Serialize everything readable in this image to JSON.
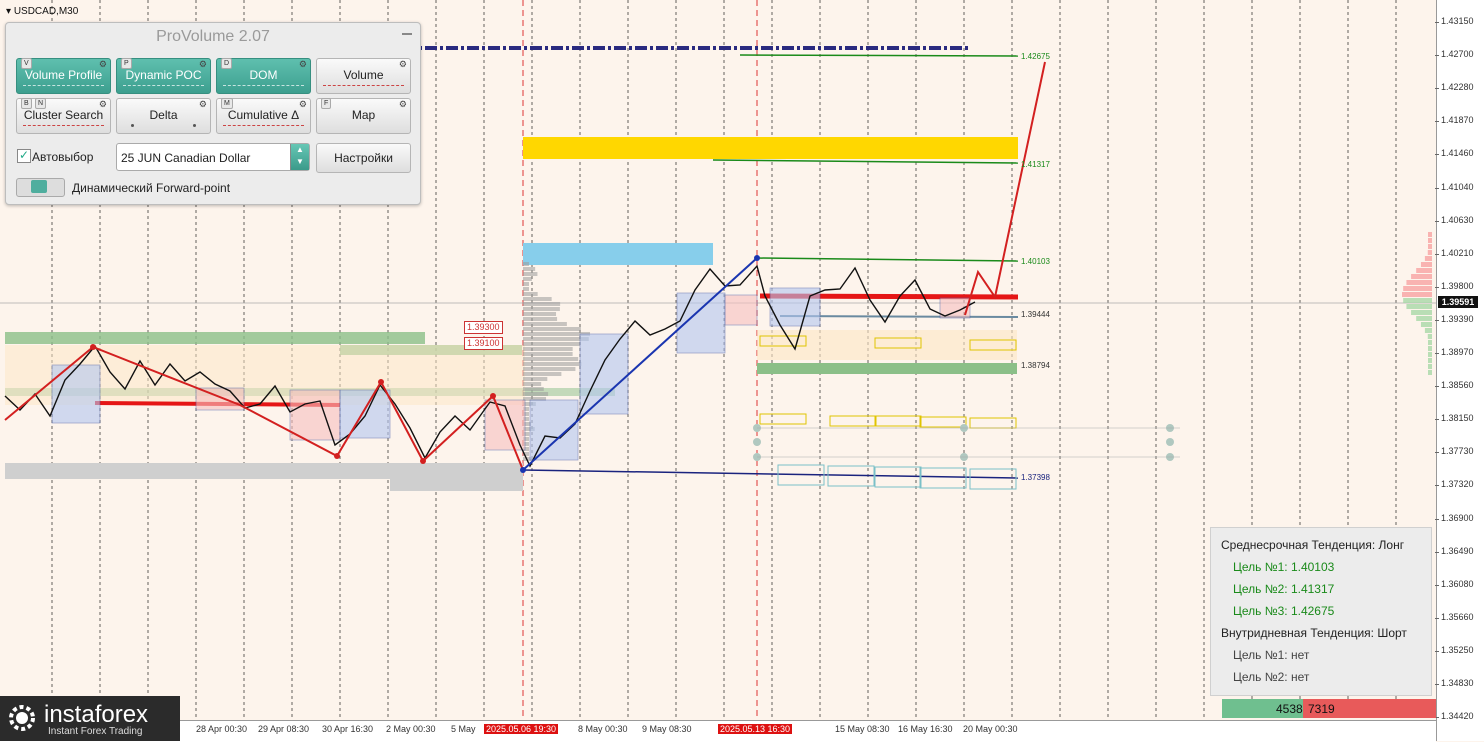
{
  "symbol": "USDCAD,M30",
  "panel": {
    "title": "ProVolume 2.07",
    "buttons": [
      {
        "label": "Volume Profile",
        "hotkey": "V",
        "active": true
      },
      {
        "label": "Dynamic POC",
        "hotkey": "P",
        "active": true
      },
      {
        "label": "DOM",
        "hotkey": "D",
        "active": true
      },
      {
        "label": "Volume",
        "hotkey": "",
        "active": false
      },
      {
        "label": "Cluster Search",
        "hotkey": "B",
        "hotkey2": "N",
        "active": false
      },
      {
        "label": "Delta",
        "hotkey": "",
        "active": false
      },
      {
        "label": "Cumulative Δ",
        "hotkey": "M",
        "active": false
      },
      {
        "label": "Map",
        "hotkey": "F",
        "active": false
      }
    ],
    "auto_select_label": "Автовыбор",
    "instrument": "25 JUN Canadian Dollar",
    "settings_label": "Настройки",
    "forward_point_label": "Динамический Forward-point"
  },
  "price_axis": [
    "1.43150",
    "1.42700",
    "1.42280",
    "1.41870",
    "1.41460",
    "1.41040",
    "1.40630",
    "1.40210",
    "1.39800",
    "1.39390",
    "1.38970",
    "1.38560",
    "1.38150",
    "1.37730",
    "1.37320",
    "1.36900",
    "1.36490",
    "1.36080",
    "1.35660",
    "1.35250",
    "1.34830",
    "1.34420"
  ],
  "current_price": "1.39591",
  "time_axis": [
    {
      "label": "28 Apr 00:30"
    },
    {
      "label": "29 Apr 08:30"
    },
    {
      "label": "30 Apr 16:30"
    },
    {
      "label": "2 May 00:30"
    },
    {
      "label": "5 May"
    },
    {
      "label": "2025.05.06 19:30",
      "highlight": true
    },
    {
      "label": "8 May 00:30"
    },
    {
      "label": "9 May 08:30"
    },
    {
      "label": "2025.05.13 16:30",
      "highlight": true
    },
    {
      "label": "15 May 08:30"
    },
    {
      "label": "16 May 16:30"
    },
    {
      "label": "20 May 00:30"
    }
  ],
  "levels": {
    "t3": "1.42675",
    "t2": "1.41317",
    "t1": "1.40103",
    "l1": "1.39444",
    "l2": "1.38794",
    "l3": "1.37398",
    "box1": "1.39300",
    "box2": "1.39100"
  },
  "info": {
    "mid_trend": "Среднесрочная Тенденция: Лонг",
    "target1": "Цель №1: 1.40103",
    "target2": "Цель №2: 1.41317",
    "target3": "Цель №3: 1.42675",
    "intraday_trend": "Внутридневная Тенденция: Шорт",
    "intraday1": "Цель №1: нет",
    "intraday2": "Цель №2: нет"
  },
  "volume_bar": {
    "buy": "4538",
    "sell": "7319",
    "buy_share": 0.38
  },
  "logo": {
    "brand": "instaforex",
    "tagline": "Instant Forex Trading"
  }
}
